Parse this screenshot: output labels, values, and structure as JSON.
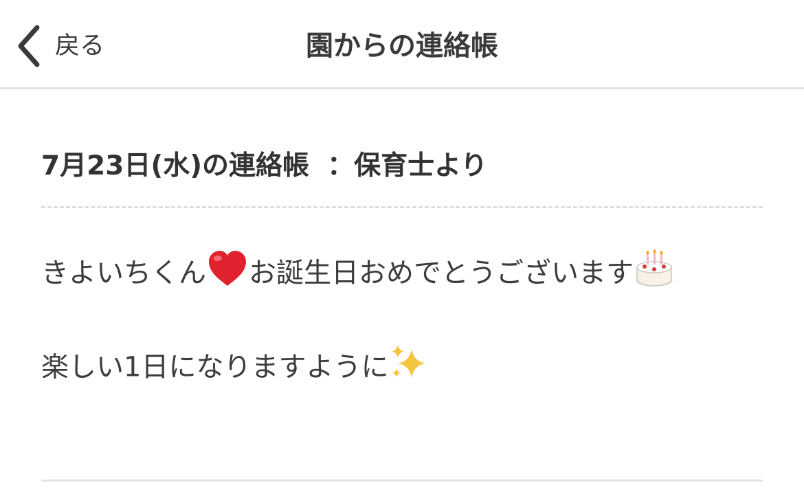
{
  "nav": {
    "back_label": "戻る",
    "title": "園からの連絡帳"
  },
  "entry": {
    "date_title": "7月23日(水)の連絡帳",
    "author": "：保育士より"
  },
  "message": {
    "line1_part1": "きよいちくん",
    "line1_part2": "お誕生日おめでとうございます",
    "line2": "楽しい1日になりますように",
    "emojis": [
      "heart",
      "birthday-cake",
      "sparkles"
    ]
  },
  "colors": {
    "text": "#333333",
    "divider": "#e4e4e4",
    "dashed_divider": "#dedede",
    "heart": "#e0222e",
    "sparkle": "#f5c542"
  }
}
